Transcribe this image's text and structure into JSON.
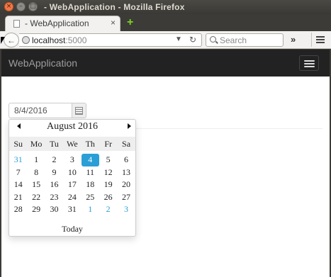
{
  "window": {
    "title": "- WebApplication - Mozilla Firefox"
  },
  "browser": {
    "tab_title": "- WebApplication",
    "url_host": "localhost",
    "url_port": ":5000",
    "search_placeholder": "Search",
    "tab_close_glyph": "×",
    "newtab_glyph": "+",
    "overflow_glyph": "»"
  },
  "site": {
    "brand": "WebApplication"
  },
  "date_input": {
    "value": "8/4/2016"
  },
  "picker": {
    "month_title": "August 2016",
    "weekdays": [
      "Su",
      "Mo",
      "Tu",
      "We",
      "Th",
      "Fr",
      "Sa"
    ],
    "weeks": [
      [
        "31",
        "1",
        "2",
        "3",
        "4",
        "5",
        "6"
      ],
      [
        "7",
        "8",
        "9",
        "10",
        "11",
        "12",
        "13"
      ],
      [
        "14",
        "15",
        "16",
        "17",
        "18",
        "19",
        "20"
      ],
      [
        "21",
        "22",
        "23",
        "24",
        "25",
        "26",
        "27"
      ],
      [
        "28",
        "29",
        "30",
        "31",
        "1",
        "2",
        "3"
      ]
    ],
    "selected": "4",
    "today_label": "Today",
    "accent": "#2a9fd6"
  }
}
